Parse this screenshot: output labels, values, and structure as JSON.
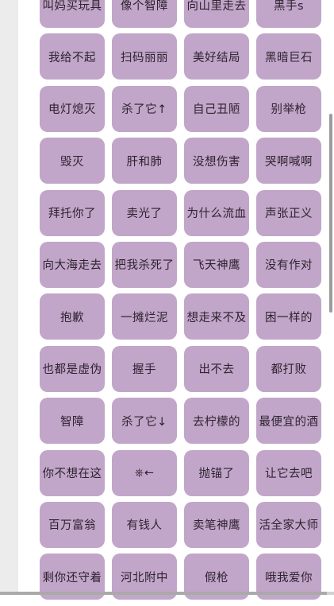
{
  "grid": {
    "rows": [
      [
        "叫妈买玩具",
        "像个智障",
        "向山里走去",
        "黑手s"
      ],
      [
        "我给不起",
        "扫码丽丽",
        "美好结局",
        "黑暗巨石"
      ],
      [
        "电灯熄灭",
        "杀了它↑",
        "自己丑陋",
        "别举枪"
      ],
      [
        "毁灭",
        "肝和肺",
        "没想伤害",
        "哭啊喊啊"
      ],
      [
        "拜托你了",
        "卖光了",
        "为什么流血",
        "声张正义"
      ],
      [
        "向大海走去",
        "把我杀死了",
        "飞天神鹰",
        "没有作对"
      ],
      [
        "抱歉",
        "一摊烂泥",
        "想走来不及",
        "困一样的"
      ],
      [
        "也都是虚伪",
        "握手",
        "出不去",
        "都打败"
      ],
      [
        "智障",
        "杀了它↓",
        "去柠檬的",
        "最便宜的酒"
      ],
      [
        "你不想在这",
        "⎈←",
        "抛锚了",
        "让它去吧"
      ],
      [
        "百万富翁",
        "有钱人",
        "卖笔神鹰",
        "活全家大师"
      ],
      [
        "剩你还守着",
        "河北附中",
        "假枪",
        "哦我爱你"
      ]
    ]
  },
  "colors": {
    "tile_background": "#c1a6c9",
    "tile_text": "#2e2230",
    "page_background": "#ffffff",
    "left_strip": "#ececec"
  }
}
